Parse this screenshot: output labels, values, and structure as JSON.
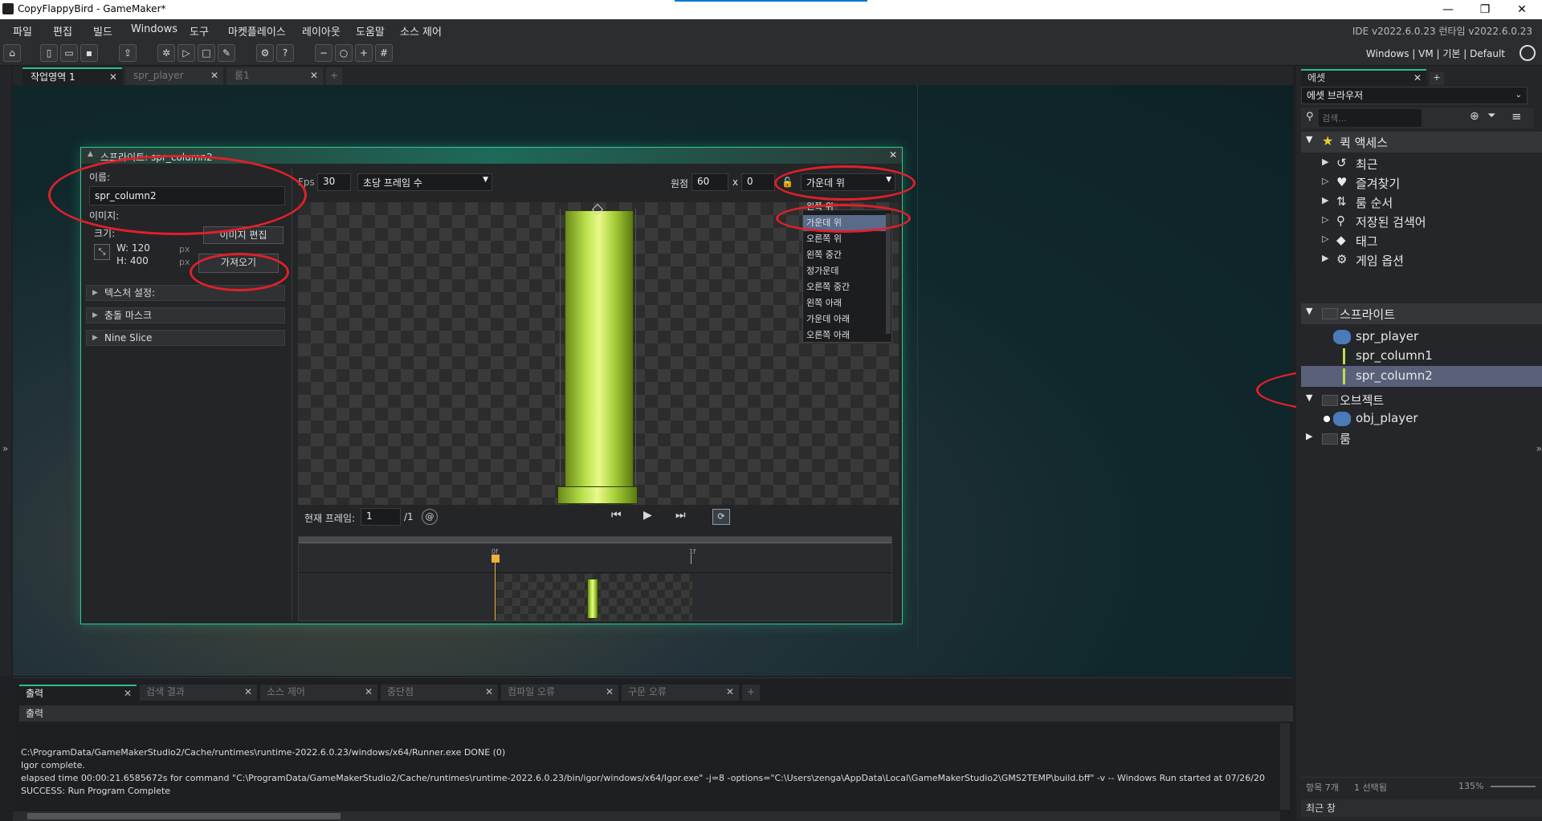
{
  "titlebar": {
    "title": "CopyFlappyBird - GameMaker*",
    "minimize": "—",
    "maximize": "❐",
    "close": "✕"
  },
  "menu": {
    "items": [
      "파일",
      "편집",
      "빌드",
      "Windows",
      "도구",
      "마켓플레이스",
      "레이아웃",
      "도움말",
      "소스 제어"
    ],
    "version": "IDE v2022.6.0.23  런타임 v2022.6.0.23"
  },
  "toolbar": {
    "targets": "Windows | VM | 기본 | Default"
  },
  "tabs": [
    {
      "label": "작업영역 1",
      "close": "✕"
    },
    {
      "label": "spr_player",
      "close": "✕"
    },
    {
      "label": "룸1",
      "close": "✕"
    },
    {
      "label": "+"
    }
  ],
  "sprite_editor": {
    "title": "스프라이트: spr_column2",
    "name_label": "이름:",
    "name_value": "spr_column2",
    "image_label": "이미지:",
    "size_label": "크기:",
    "edit_image": "이미지 편집",
    "width": "W: 120",
    "height": "H: 400",
    "px": "px",
    "import": "가져오기",
    "sections": [
      "텍스처 설정:",
      "충돌 마스크",
      "Nine Slice"
    ],
    "fps_label": "Fps",
    "fps_value": "30",
    "fps_mode": "초당 프레임 수",
    "origin_label": "원점",
    "origin_x": "60",
    "origin_x_sep": "x",
    "origin_y": "0",
    "origin_mode": "가운데 위",
    "origin_options": [
      "왼쪽 위",
      "가운데 위",
      "오른쪽 위",
      "왼쪽 중간",
      "정가운데",
      "오른쪽 중간",
      "왼쪽 아래",
      "가운데 아래",
      "오른쪽 아래"
    ],
    "current_frame_label": "현재 프레임:",
    "current_frame": "1",
    "frame_total": "/1",
    "timeline_marks": [
      "0f",
      "1f"
    ]
  },
  "output": {
    "tabs": [
      "출력",
      "검색 결과",
      "소스 제어",
      "중단점",
      "컴파일 오류",
      "구문 오류",
      "+"
    ],
    "header": "출력",
    "lines": [
      "C:\\ProgramData/GameMakerStudio2/Cache/runtimes\\runtime-2022.6.0.23/windows/x64/Runner.exe DONE (0)",
      "Igor complete.",
      "elapsed time 00:00:21.6585672s for command \"C:\\ProgramData/GameMakerStudio2/Cache/runtimes\\runtime-2022.6.0.23/bin/igor/windows/x64/Igor.exe\" -j=8 -options=\"C:\\Users\\zenga\\AppData\\Local\\GameMakerStudio2\\GMS2TEMP\\build.bff\" -v -- Windows Run started at 07/26/20",
      "SUCCESS: Run Program Complete"
    ]
  },
  "assets": {
    "tab": "에셋",
    "browser": "에셋 브라우저",
    "search_placeholder": "검색...",
    "quick_access": "퀵 액세스",
    "quick_items": [
      "최근",
      "즐겨찾기",
      "룸 순서",
      "저장된 검색어",
      "태그",
      "게임 옵션"
    ],
    "sprites_group": "스프라이트",
    "sprites": [
      "spr_player",
      "spr_column1",
      "spr_column2"
    ],
    "objects_group": "오브젝트",
    "objects": [
      "obj_player"
    ],
    "rooms_group": "룸",
    "status_items": "항목 7개",
    "status_selected": "1 선택됨",
    "zoom": "135%",
    "recent_window": "최근 창"
  },
  "colors": {
    "accent": "#2ebf8a",
    "highlight": "#e0202a",
    "selection": "#59617a"
  }
}
